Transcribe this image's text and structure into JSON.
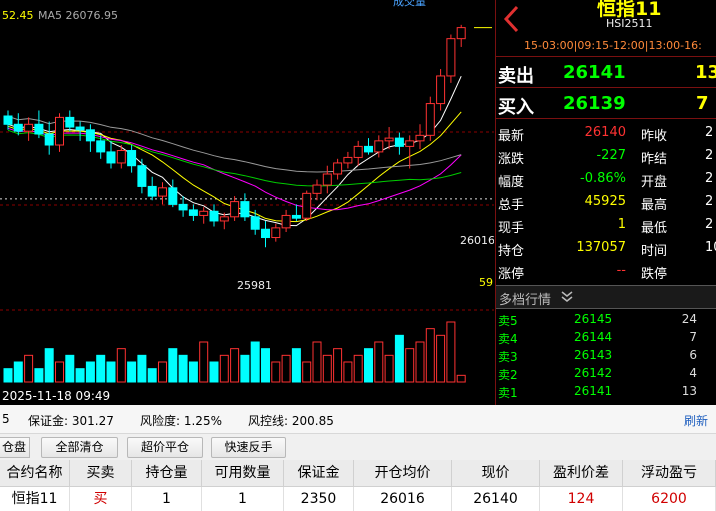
{
  "chart": {
    "ma_labels": [
      {
        "text": "52.45",
        "color": "#ffff00"
      },
      {
        "text": "MA5 26076.95",
        "color": "#aaaaaa"
      }
    ],
    "top_right_label": "成交量",
    "price_ref_label": "26016",
    "low_label": "25981",
    "small_label": "59",
    "time_label": "2025-11-18 09:49",
    "colors": {
      "up": "#ff3232",
      "down": "#00ffff",
      "ma_white": "#ffffff",
      "ma_yellow": "#ffff00",
      "ma_magenta": "#ff00ff",
      "ma_green": "#00cc00",
      "ma_gray": "#999999",
      "grid": "#8b0000",
      "ref_line": "#dddddd"
    }
  },
  "chart_data": {
    "type": "candlestick",
    "title": "",
    "time_label": "2025-11-18 09:49",
    "reference_price": 26016,
    "marked_low": 25981,
    "note_price_axis_range": [
      25950,
      26160
    ],
    "candles": [
      {
        "o": 26076,
        "h": 26080,
        "l": 26066,
        "c": 26070
      },
      {
        "o": 26070,
        "h": 26078,
        "l": 26062,
        "c": 26065
      },
      {
        "o": 26065,
        "h": 26075,
        "l": 26058,
        "c": 26070
      },
      {
        "o": 26070,
        "h": 26080,
        "l": 26060,
        "c": 26063
      },
      {
        "o": 26063,
        "h": 26072,
        "l": 26048,
        "c": 26055
      },
      {
        "o": 26055,
        "h": 26078,
        "l": 26050,
        "c": 26075
      },
      {
        "o": 26075,
        "h": 26080,
        "l": 26065,
        "c": 26068
      },
      {
        "o": 26068,
        "h": 26072,
        "l": 26058,
        "c": 26066
      },
      {
        "o": 26066,
        "h": 26070,
        "l": 26050,
        "c": 26058
      },
      {
        "o": 26058,
        "h": 26062,
        "l": 26045,
        "c": 26050
      },
      {
        "o": 26050,
        "h": 26058,
        "l": 26038,
        "c": 26042
      },
      {
        "o": 26042,
        "h": 26055,
        "l": 26038,
        "c": 26051
      },
      {
        "o": 26051,
        "h": 26055,
        "l": 26035,
        "c": 26040
      },
      {
        "o": 26040,
        "h": 26045,
        "l": 26020,
        "c": 26025
      },
      {
        "o": 26025,
        "h": 26032,
        "l": 26015,
        "c": 26018
      },
      {
        "o": 26018,
        "h": 26028,
        "l": 26012,
        "c": 26024
      },
      {
        "o": 26024,
        "h": 26030,
        "l": 26010,
        "c": 26012
      },
      {
        "o": 26012,
        "h": 26018,
        "l": 26003,
        "c": 26008
      },
      {
        "o": 26008,
        "h": 26012,
        "l": 26000,
        "c": 26004
      },
      {
        "o": 26004,
        "h": 26010,
        "l": 25998,
        "c": 26007
      },
      {
        "o": 26007,
        "h": 26012,
        "l": 25996,
        "c": 26000
      },
      {
        "o": 26000,
        "h": 26006,
        "l": 25994,
        "c": 26003
      },
      {
        "o": 26003,
        "h": 26018,
        "l": 26000,
        "c": 26014
      },
      {
        "o": 26014,
        "h": 26020,
        "l": 26000,
        "c": 26003
      },
      {
        "o": 26003,
        "h": 26008,
        "l": 25990,
        "c": 25994
      },
      {
        "o": 25994,
        "h": 26000,
        "l": 25981,
        "c": 25988
      },
      {
        "o": 25988,
        "h": 25998,
        "l": 25985,
        "c": 25995
      },
      {
        "o": 25995,
        "h": 26008,
        "l": 25992,
        "c": 26004
      },
      {
        "o": 26004,
        "h": 26012,
        "l": 26000,
        "c": 26002
      },
      {
        "o": 26002,
        "h": 26022,
        "l": 26000,
        "c": 26020
      },
      {
        "o": 26020,
        "h": 26030,
        "l": 26015,
        "c": 26026
      },
      {
        "o": 26026,
        "h": 26040,
        "l": 26020,
        "c": 26034
      },
      {
        "o": 26034,
        "h": 26045,
        "l": 26030,
        "c": 26042
      },
      {
        "o": 26042,
        "h": 26050,
        "l": 26038,
        "c": 26046
      },
      {
        "o": 26046,
        "h": 26058,
        "l": 26040,
        "c": 26054
      },
      {
        "o": 26054,
        "h": 26060,
        "l": 26048,
        "c": 26050
      },
      {
        "o": 26050,
        "h": 26062,
        "l": 26046,
        "c": 26058
      },
      {
        "o": 26058,
        "h": 26068,
        "l": 26052,
        "c": 26060
      },
      {
        "o": 26060,
        "h": 26064,
        "l": 26048,
        "c": 26054
      },
      {
        "o": 26054,
        "h": 26062,
        "l": 26038,
        "c": 26058
      },
      {
        "o": 26058,
        "h": 26070,
        "l": 26052,
        "c": 26062
      },
      {
        "o": 26062,
        "h": 26090,
        "l": 26058,
        "c": 26085
      },
      {
        "o": 26085,
        "h": 26110,
        "l": 26080,
        "c": 26105
      },
      {
        "o": 26105,
        "h": 26135,
        "l": 26100,
        "c": 26132
      },
      {
        "o": 26132,
        "h": 26142,
        "l": 26126,
        "c": 26140
      }
    ],
    "volume": [
      2,
      3,
      4,
      2,
      5,
      3,
      4,
      2,
      3,
      4,
      3,
      5,
      3,
      4,
      2,
      3,
      5,
      4,
      3,
      6,
      3,
      4,
      5,
      4,
      6,
      5,
      3,
      4,
      5,
      3,
      6,
      4,
      5,
      3,
      4,
      5,
      6,
      4,
      7,
      5,
      6,
      8,
      7,
      9,
      1
    ]
  },
  "header": {
    "symbol_name": "恒指11",
    "symbol_code": "HSI2511",
    "session_times": "15-03:00|09:15-12:00|13:00-16:",
    "back_arrow": "chevron-left-icon"
  },
  "book": {
    "sell_label": "卖出",
    "sell_price": "26141",
    "sell_qty": "13",
    "buy_label": "买入",
    "buy_price": "26139",
    "buy_qty": "7"
  },
  "quote": {
    "rows": [
      {
        "l1": "最新",
        "v1": "26140",
        "c1": "#ff3232",
        "l2": "昨收",
        "v2": "2"
      },
      {
        "l1": "涨跌",
        "v1": "-227",
        "c1": "#00ff00",
        "l2": "昨结",
        "v2": "2"
      },
      {
        "l1": "幅度",
        "v1": "-0.86%",
        "c1": "#00ff00",
        "l2": "开盘",
        "v2": "2"
      },
      {
        "l1": "总手",
        "v1": "45925",
        "c1": "#ffff00",
        "l2": "最高",
        "v2": "2"
      },
      {
        "l1": "现手",
        "v1": "1",
        "c1": "#ffff00",
        "l2": "最低",
        "v2": "2"
      },
      {
        "l1": "持仓",
        "v1": "137057",
        "c1": "#ffff00",
        "l2": "时间",
        "v2": "10:"
      },
      {
        "l1": "涨停",
        "v1": "--",
        "c1": "#ff3232",
        "l2": "跌停",
        "v2": ""
      }
    ]
  },
  "depth": {
    "title": "多档行情",
    "rows": [
      {
        "label": "卖5",
        "price": "26145",
        "qty": "24"
      },
      {
        "label": "卖4",
        "price": "26144",
        "qty": "7"
      },
      {
        "label": "卖3",
        "price": "26143",
        "qty": "6"
      },
      {
        "label": "卖2",
        "price": "26142",
        "qty": "4"
      },
      {
        "label": "卖1",
        "price": "26141",
        "qty": "13"
      }
    ]
  },
  "account": {
    "partial_left": "5",
    "margin_label": "保证金: 301.27",
    "risk_label": "风险度: 1.25%",
    "control_label": "风控线: 200.85",
    "refresh": "刷新"
  },
  "buttons": {
    "partial": "仓盘",
    "close_all": "全部清仓",
    "super_close": "超价平仓",
    "quick_reverse": "快速反手"
  },
  "positions": {
    "headers": [
      "合约名称",
      "买卖",
      "持仓量",
      "可用数量",
      "保证金",
      "开仓均价",
      "现价",
      "盈利价差",
      "浮动盈亏"
    ],
    "row": [
      "恒指11",
      "买",
      "1",
      "1",
      "2350",
      "26016",
      "26140",
      "124",
      "6200"
    ]
  }
}
